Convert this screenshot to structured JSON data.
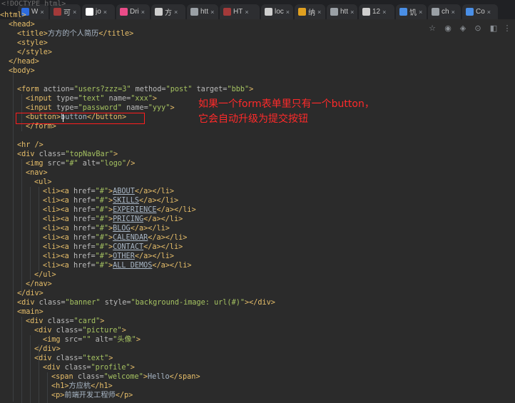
{
  "browser": {
    "tabs": [
      {
        "label": "W",
        "fav": "#2d6cdf",
        "icon": "wikipedia-icon"
      },
      {
        "label": "可",
        "fav": "#a33a3a",
        "icon": "site-icon"
      },
      {
        "label": "jo",
        "fav": "#ffffff",
        "icon": "github-icon"
      },
      {
        "label": "Dri",
        "fav": "#ea4c89",
        "icon": "dribbble-icon"
      },
      {
        "label": "方",
        "fav": "#cfcfcf",
        "icon": "page-icon"
      },
      {
        "label": "htt",
        "fav": "#9aa0a6",
        "icon": "google-icon"
      },
      {
        "label": "HT",
        "fav": "#a33a3a",
        "icon": "site-icon"
      },
      {
        "label": "loc",
        "fav": "#cfcfcf",
        "icon": "page-icon"
      },
      {
        "label": "纳",
        "fav": "#e0a020",
        "icon": "site-icon"
      },
      {
        "label": "htt",
        "fav": "#9aa0a6",
        "icon": "google-icon"
      },
      {
        "label": "12",
        "fav": "#cfcfcf",
        "icon": "page-icon"
      },
      {
        "label": "饥",
        "fav": "#4a8fe7",
        "icon": "site-icon"
      },
      {
        "label": "ch",
        "fav": "#9aa0a6",
        "icon": "google-icon"
      },
      {
        "label": "Co",
        "fav": "#4a8fe7",
        "icon": "info-icon"
      }
    ],
    "tab_close": "×",
    "toolbar_icons": [
      "☆",
      "◉",
      "◈",
      "⊙",
      "◧",
      "⋮"
    ]
  },
  "editor": {
    "doctype": "<!DOCTYPE html>"
  },
  "annotation": {
    "line1": "如果一个form表单里只有一个button，",
    "line2": "它会自动升级为提交按钮"
  }
}
